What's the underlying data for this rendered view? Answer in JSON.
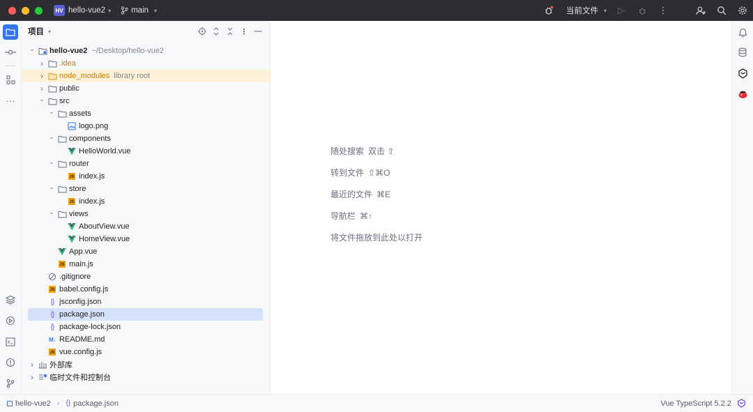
{
  "titlebar": {
    "project_badge": "HV",
    "project_name": "hello-vue2",
    "branch": "main",
    "run_config": "当前文件"
  },
  "panel": {
    "title": "项目"
  },
  "tree": [
    {
      "label": "hello-vue2",
      "extra": "~/Desktop/hello-vue2",
      "icon": "module-folder",
      "arrow": "open",
      "depth": 0
    },
    {
      "label": ".idea",
      "icon": "folder",
      "arrow": "closed",
      "depth": 1
    },
    {
      "label": "node_modules",
      "extra": "library root",
      "icon": "folder-excluded",
      "arrow": "closed",
      "depth": 1
    },
    {
      "label": "public",
      "icon": "folder",
      "arrow": "closed",
      "depth": 1
    },
    {
      "label": "src",
      "icon": "folder",
      "arrow": "open",
      "depth": 1
    },
    {
      "label": "assets",
      "icon": "folder",
      "arrow": "open",
      "depth": 2
    },
    {
      "label": "logo.png",
      "icon": "image",
      "depth": 3
    },
    {
      "label": "components",
      "icon": "folder",
      "arrow": "open",
      "depth": 2
    },
    {
      "label": "HelloWorld.vue",
      "icon": "vue",
      "depth": 3
    },
    {
      "label": "router",
      "icon": "folder",
      "arrow": "open",
      "depth": 2
    },
    {
      "label": "index.js",
      "icon": "js",
      "depth": 3
    },
    {
      "label": "store",
      "icon": "folder",
      "arrow": "open",
      "depth": 2
    },
    {
      "label": "index.js",
      "icon": "js",
      "depth": 3
    },
    {
      "label": "views",
      "icon": "folder",
      "arrow": "open",
      "depth": 2
    },
    {
      "label": "AboutView.vue",
      "icon": "vue",
      "depth": 3
    },
    {
      "label": "HomeView.vue",
      "icon": "vue",
      "depth": 3
    },
    {
      "label": "App.vue",
      "icon": "vue",
      "depth": 2
    },
    {
      "label": "main.js",
      "icon": "js",
      "depth": 2
    },
    {
      "label": ".gitignore",
      "icon": "ignore",
      "depth": 1
    },
    {
      "label": "babel.config.js",
      "icon": "js",
      "depth": 1
    },
    {
      "label": "jsconfig.json",
      "icon": "json",
      "depth": 1
    },
    {
      "label": "package.json",
      "icon": "json",
      "depth": 1,
      "selected": true
    },
    {
      "label": "package-lock.json",
      "icon": "json",
      "depth": 1
    },
    {
      "label": "README.md",
      "icon": "md",
      "depth": 1
    },
    {
      "label": "vue.config.js",
      "icon": "js",
      "depth": 1
    },
    {
      "label": "外部库",
      "icon": "library",
      "arrow": "closed",
      "depth": 0
    },
    {
      "label": "临时文件和控制台",
      "icon": "scratch",
      "arrow": "closed",
      "depth": 0
    }
  ],
  "editor_hints": [
    {
      "text": "随处搜索",
      "shortcut": "双击 ⇧"
    },
    {
      "text": "转到文件",
      "shortcut": "⇧⌘O"
    },
    {
      "text": "最近的文件",
      "shortcut": "⌘E"
    },
    {
      "text": "导航栏",
      "shortcut": "⌘↑"
    },
    {
      "text": "将文件拖放到此处以打开",
      "shortcut": ""
    }
  ],
  "statusbar": {
    "crumb_project": "hello-vue2",
    "crumb_file": "package.json",
    "language_service": "Vue TypeScript 5.2.2"
  },
  "colors": {
    "titlebar_bg": "#2b2d30",
    "accent": "#3574f0",
    "selection": "#d5e1f9",
    "excluded_highlight": "#fdf2d8",
    "vue_green": "#41b883",
    "js_badge": "#f0a30a"
  }
}
